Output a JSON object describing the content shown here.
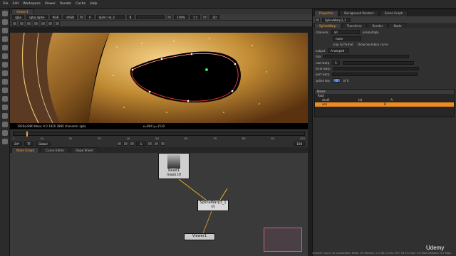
{
  "menu": [
    "File",
    "Edit",
    "Workspace",
    "Viewer",
    "Render",
    "Cache",
    "Help"
  ],
  "viewer_tab": "Viewer1",
  "viewer_bar": {
    "channels": "rgba",
    "alpha": "rgba.alpha",
    "colorspace": "RGB",
    "format": "sRGB",
    "node_a": "A",
    "node_a_val": "Splin: nd_3",
    "node_b": "B",
    "node_b_val": "",
    "zoom": "100%",
    "proxy": "1:1",
    "mode": "2D"
  },
  "viewer_status": {
    "format": "1920x2880  bbox: 0 0 1920 2880 channels: rgba",
    "coords": "x=894 y=1510"
  },
  "timeline": {
    "frame": "1",
    "fps": "24*",
    "tf": "TF",
    "range": "Global",
    "ticks": [
      "1",
      "10",
      "20",
      "30",
      "40",
      "50",
      "60",
      "70",
      "80",
      "90",
      "100"
    ],
    "end_frame": "100"
  },
  "node_graph_tabs": [
    "Node Graph",
    "Curve Editor",
    "Dope Sheet"
  ],
  "nodes": {
    "read": "Read1\nmask.tif",
    "read_title": "Read1",
    "read_file": "mask.tif",
    "splinewarp": "SplineWarp3_1",
    "splinewarp_sub": "(I)",
    "viewer": "Viewer1"
  },
  "status_bar": "Channel Count: 22  Localization Mode: On  Memory: 1.2 GB (3.0%)  CPU: 59.4%  Disk: 0.0 MB/s  Network: 0.0 MB/s",
  "props": {
    "tabs": [
      "Properties",
      "Background Renders",
      "Scene Graph"
    ],
    "node_name": "SplineWarp3_1",
    "sub_tabs": [
      "SplineWarp",
      "Transform",
      "Render",
      "Node"
    ],
    "channels_label": "channels",
    "channels_value": "all",
    "premultiply": "premultiply",
    "channels_value2": "none",
    "crop_to_format": "crop to format",
    "show_boundary": "show boundary curve",
    "output_label": "output",
    "output_value": "A warped",
    "root_warp": "root warp",
    "mix": "mix",
    "root_warp_v": "1",
    "local_warp": "local warp",
    "part_warp": "part warp",
    "spline_key": "spline key",
    "spline_key_val": "0",
    "spline_key_of": "of 0",
    "tree_header": "Name",
    "tree_root": "Root",
    "tree_rows": [
      {
        "name": "dsst1",
        "label": "(a)",
        "val": "A"
      },
      {
        "name": "eco",
        "label": "",
        "val": "B"
      }
    ]
  },
  "watermark": "Udemy"
}
